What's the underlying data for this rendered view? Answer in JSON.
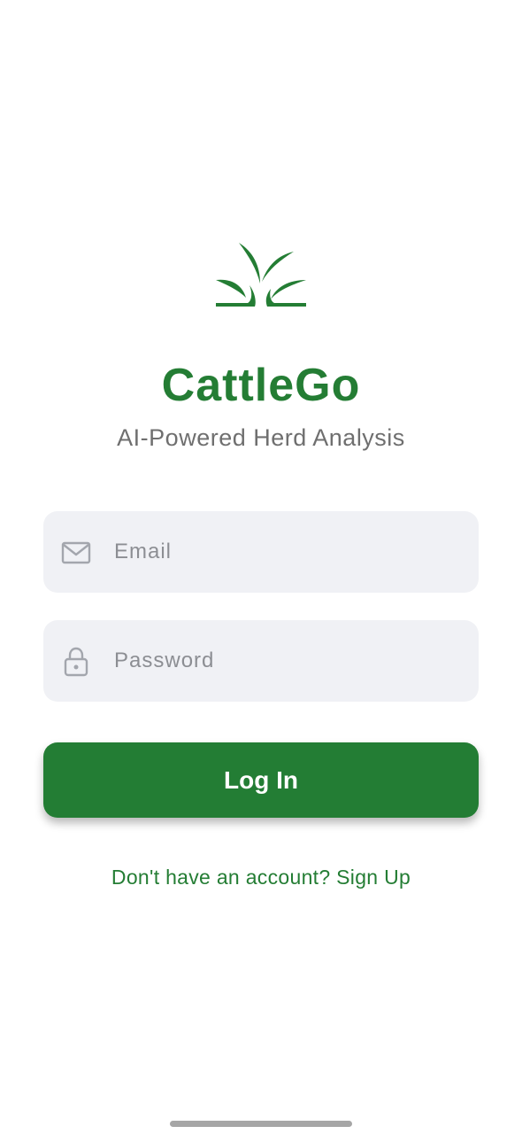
{
  "app": {
    "title": "CattleGo",
    "subtitle": "AI-Powered Herd Analysis",
    "logo_icon": "grass-sprout-icon",
    "brand_color": "#247d34"
  },
  "form": {
    "email": {
      "placeholder": "Email",
      "value": "",
      "icon": "mail-icon"
    },
    "password": {
      "placeholder": "Password",
      "value": "",
      "icon": "lock-icon"
    },
    "login_label": "Log In",
    "signup_text": "Don't have an account? Sign Up"
  },
  "colors": {
    "input_background": "#f0f1f5",
    "placeholder": "#8c8e93",
    "subtitle": "#6f6f6f"
  }
}
